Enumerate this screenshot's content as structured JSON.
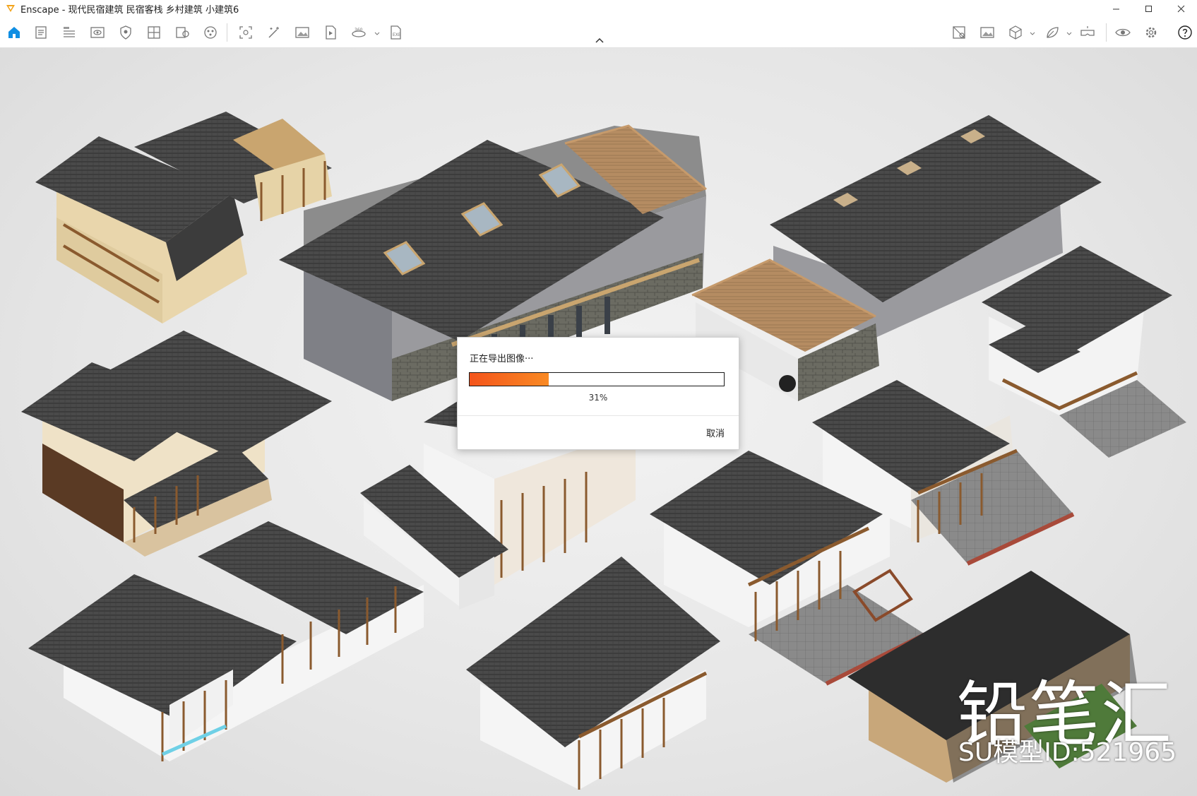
{
  "window": {
    "title": "Enscape - 现代民宿建筑 民宿客栈 乡村建筑 小建筑6",
    "accent": "#f2a31b"
  },
  "toolbar": {
    "icons": [
      "home-icon",
      "project-icon",
      "bim-icon",
      "view-icon",
      "visual-settings-icon",
      "asset-library-icon",
      "material-editor-icon",
      "site-context-icon",
      "screenshot-icon",
      "batch-render-icon",
      "image-export-icon",
      "video-export-icon",
      "panorama-icon",
      "exe-export-icon",
      "sync-views-icon",
      "image-gallery-icon",
      "cube-icon",
      "paint-icon",
      "vr-headset-icon",
      "preview-eye-icon",
      "settings-icon",
      "help-icon"
    ],
    "accent": "#0f8ee3"
  },
  "dialog": {
    "title": "正在导出图像···",
    "progress": 0.31,
    "progress_label": "31%",
    "cancel_label": "取消",
    "fill_from": "#f4541b",
    "fill_to": "#f98a24"
  },
  "watermark": {
    "brand": "铅笔汇",
    "model_id": "SU模型ID:521965"
  }
}
